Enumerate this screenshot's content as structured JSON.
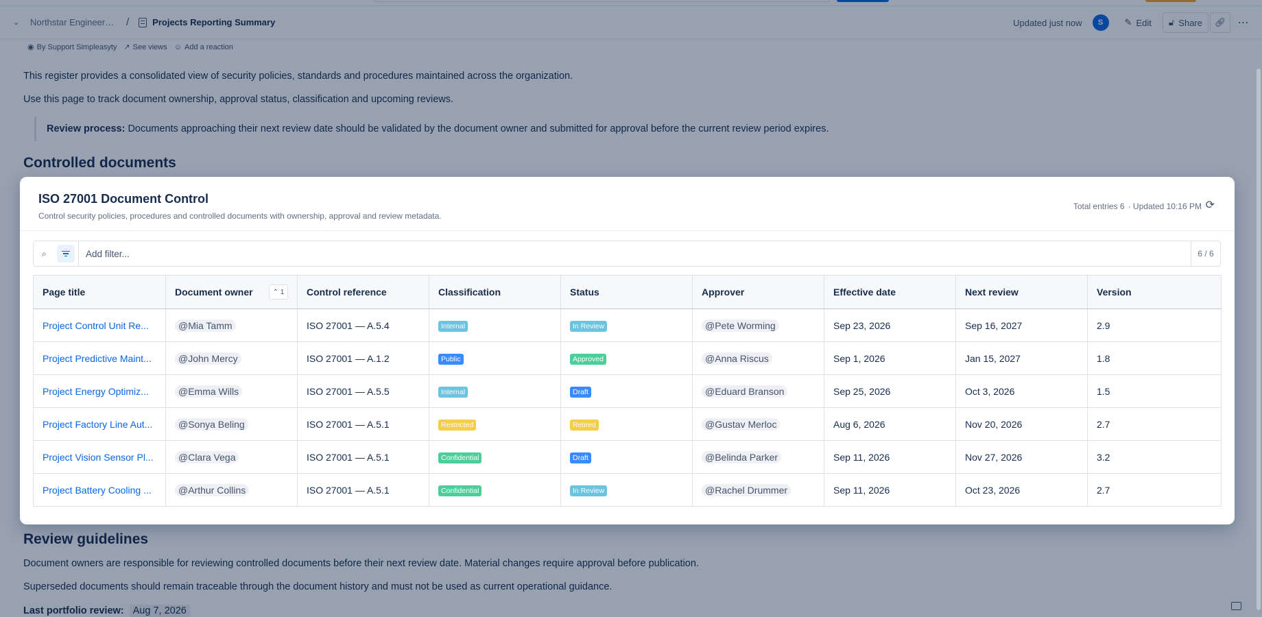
{
  "header": {
    "breadcrumb_parent": "Northstar Engineering",
    "breadcrumb_separator": "/",
    "page_title": "Projects Reporting Summary",
    "updated": "Updated just now",
    "avatar_initial": "S",
    "edit_label": "Edit",
    "share_label": "Share"
  },
  "byline": {
    "author": "By Support Simpleasyty",
    "views": "See views",
    "reaction": "Add a reaction"
  },
  "body": {
    "intro1": "This register provides a consolidated view of security policies, standards and procedures maintained across the organization.",
    "intro2": "Use this page to track document ownership, approval status, classification and upcoming reviews.",
    "quote_label": "Review process:",
    "quote_text": "Documents approaching their next review date should be validated by the document owner and submitted for approval before the current review period expires.",
    "heading1": "Controlled documents",
    "heading2": "Review guidelines",
    "guide1": "Document owners are responsible for reviewing controlled documents before their next review date. Material changes require approval before publication.",
    "guide2": "Superseded documents should remain traceable through the document history and must not be used as current operational guidance.",
    "last_review_label": "Last portfolio review:",
    "last_review_date": "Aug 7, 2026"
  },
  "modal": {
    "title": "ISO 27001 Document Control",
    "subtitle": "Control security policies, procedures and controlled documents with ownership, approval and review metadata.",
    "total_entries": "Total entries 6",
    "updated": "· Updated 10:16 PM",
    "filter_placeholder": "Add filter...",
    "count": "6 / 6",
    "sort_badge": "1",
    "columns": [
      "Page title",
      "Document owner",
      "Control reference",
      "Classification",
      "Status",
      "Approver",
      "Effective date",
      "Next review",
      "Version"
    ],
    "rows": [
      {
        "title": "Project Control Unit Re...",
        "owner": "@Mia Tamm",
        "control": "ISO 27001 — A.5.4",
        "classification": "Internal",
        "class_style": "c-internal",
        "status": "In Review",
        "status_style": "s-review",
        "approver": "@Pete Worming",
        "effective": "Sep 23, 2026",
        "next": "Sep 16, 2027",
        "version": "2.9"
      },
      {
        "title": "Project Predictive Maint...",
        "owner": "@John Mercy",
        "control": "ISO 27001 — A.1.2",
        "classification": "Public",
        "class_style": "c-public",
        "status": "Approved",
        "status_style": "s-approved",
        "approver": "@Anna Riscus",
        "effective": "Sep 1, 2026",
        "next": "Jan 15, 2027",
        "version": "1.8"
      },
      {
        "title": "Project Energy Optimiz...",
        "owner": "@Emma Wills",
        "control": "ISO 27001 — A.5.5",
        "classification": "Internal",
        "class_style": "c-internal",
        "status": "Draft",
        "status_style": "s-draft",
        "approver": "@Eduard Branson",
        "effective": "Sep 25, 2026",
        "next": "Oct 3, 2026",
        "version": "1.5"
      },
      {
        "title": "Project Factory Line Aut...",
        "owner": "@Sonya Beling",
        "control": "ISO 27001 — A.5.1",
        "classification": "Restricted",
        "class_style": "c-restricted",
        "status": "Retired",
        "status_style": "s-retired",
        "approver": "@Gustav Merloc",
        "effective": "Aug 6, 2026",
        "next": "Nov 20, 2026",
        "version": "2.7"
      },
      {
        "title": "Project Vision Sensor Pl...",
        "owner": "@Clara Vega",
        "control": "ISO 27001 — A.5.1",
        "classification": "Confidential",
        "class_style": "c-confidential",
        "status": "Draft",
        "status_style": "s-draft",
        "approver": "@Belinda Parker",
        "effective": "Sep 11, 2026",
        "next": "Nov 27, 2026",
        "version": "3.2"
      },
      {
        "title": "Project Battery Cooling ...",
        "owner": "@Arthur Collins",
        "control": "ISO 27001 — A.5.1",
        "classification": "Confidential",
        "class_style": "c-confidential",
        "status": "In Review",
        "status_style": "s-review",
        "approver": "@Rachel Drummer",
        "effective": "Sep 11, 2026",
        "next": "Oct 23, 2026",
        "version": "2.7"
      }
    ]
  }
}
